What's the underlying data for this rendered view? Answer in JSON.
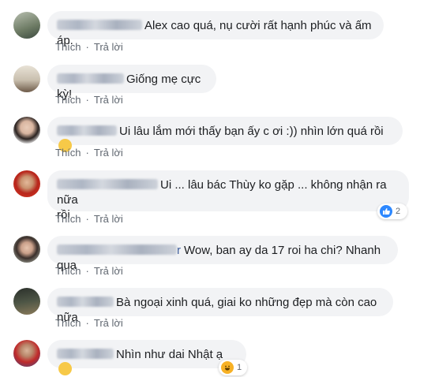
{
  "actions": {
    "like": "Thích",
    "reply": "Trả lời"
  },
  "comments": [
    {
      "text": "Alex cao quá, nụ cười rất hạnh phúc và ấm áp."
    },
    {
      "text": "Giống mẹ cực kỳ!"
    },
    {
      "text": "Ui lâu lắm mới thấy bạn ấy c ơi :)) nhìn lớn quá rồi"
    },
    {
      "text_line1": "Ui ... lâu bác Thùy ko gặp ... không nhận ra nữa",
      "text_line2": "rồi",
      "reaction_count": "2"
    },
    {
      "text": "Wow, ban ay da 17 roi ha chi? Nhanh qua",
      "name_tail": "r"
    },
    {
      "text": "Bà ngoại xinh quá, giai ko những đẹp mà còn cao nữa"
    },
    {
      "text": "Nhìn như dai Nhật ạ",
      "reaction_count": "1"
    }
  ],
  "colors": {
    "bubble": "#f2f3f5",
    "like_blue": "#2d88ff",
    "action_text": "#606770"
  }
}
